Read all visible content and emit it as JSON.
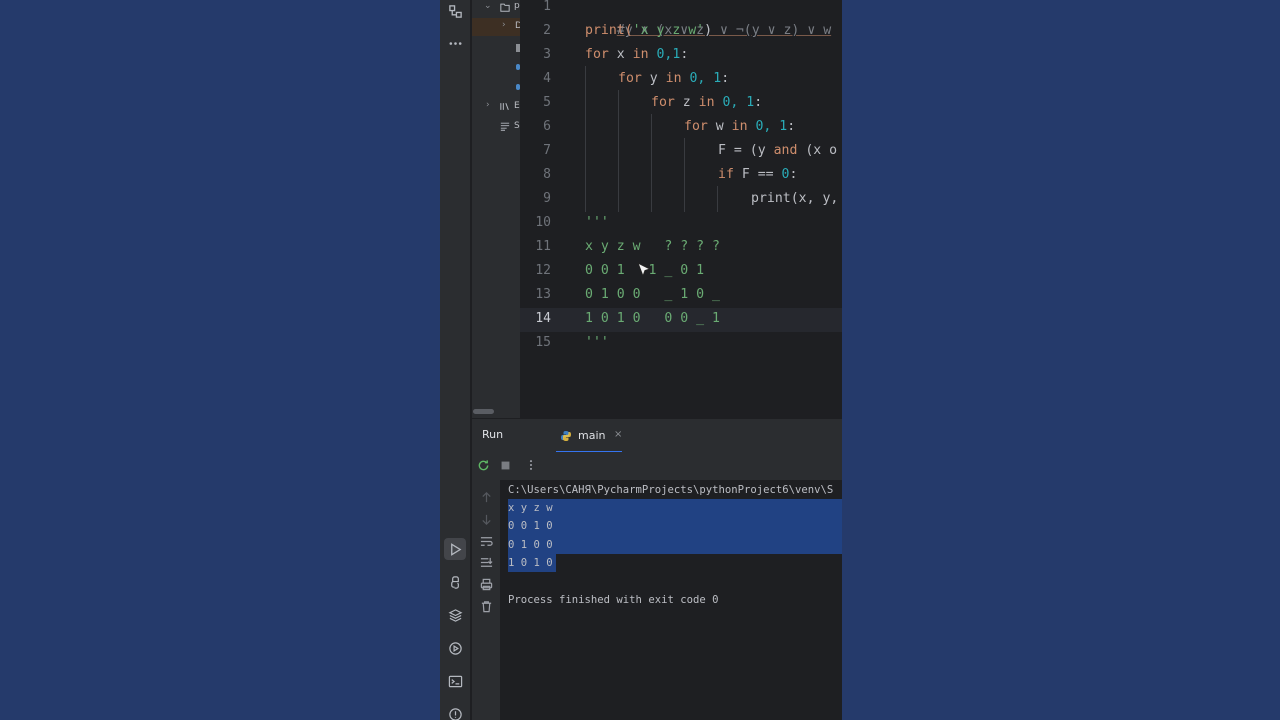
{
  "editor": {
    "line_numbers": [
      "1",
      "2",
      "3",
      "4",
      "5",
      "6",
      "7",
      "8",
      "9",
      "10",
      "11",
      "12",
      "13",
      "14",
      "15"
    ],
    "current_line": "14",
    "lines": {
      "l1_comment": "#y ∧ (x ∨ z) ∨ ¬(y ∨ z) ∨ w",
      "l2_print": "print(",
      "l2_str": "'x y z w'",
      "l2_close": ")",
      "l3_for": "for",
      "l3_var": " x ",
      "l3_in": "in",
      "l3_nums": " 0,1",
      "l3_colon": ":",
      "l4_for": "for",
      "l4_var": " y ",
      "l4_in": "in",
      "l4_nums": " 0, 1",
      "l4_colon": ":",
      "l5_for": "for",
      "l5_var": " z ",
      "l5_in": "in",
      "l5_nums": " 0, 1",
      "l5_colon": ":",
      "l6_for": "for",
      "l6_var": " w ",
      "l6_in": "in",
      "l6_nums": " 0, 1",
      "l6_colon": ":",
      "l7_a": "F = (y ",
      "l7_and": "and",
      "l7_b": " (x o",
      "l8_if": "if",
      "l8_a": " F == ",
      "l8_zero": "0",
      "l8_colon": ":",
      "l9_print": "print(x, y,",
      "l10": "'''",
      "l11": "x y z w   ? ? ? ?",
      "l12": "0 0 1 ",
      "l12_tail": "  1 _ 0 1",
      "l13": "0 1 0 0   _ 1 0 _",
      "l14": "1 0 1 0   0 0 _ 1",
      "l15": "'''"
    }
  },
  "project_tree": {
    "row1": "p",
    "row2": "D",
    "row3": "E",
    "row4": "S"
  },
  "run_panel": {
    "title": "Run",
    "tab_label": "main",
    "tab_close": "×"
  },
  "console": {
    "command": "C:\\Users\\САНЯ\\PycharmProjects\\pythonProject6\\venv\\S",
    "output": [
      "x y z w",
      "0 0 1 0",
      "0 1 0 0",
      "1 0 1 0"
    ],
    "exit_message": "Process finished with exit code 0"
  },
  "colors": {
    "background": "#253a6b",
    "ide_bg": "#1e1f22",
    "keyword": "#cf8e6d",
    "number": "#2aacb8",
    "string": "#6aab73",
    "selection": "#214283"
  }
}
